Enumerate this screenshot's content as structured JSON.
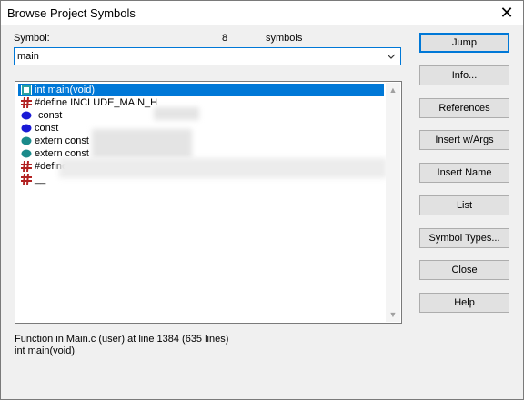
{
  "window": {
    "title": "Browse Project Symbols",
    "close_glyph": "✕"
  },
  "symbol_label": "Symbol:",
  "symbol_count": "8",
  "symbols_word": "symbols",
  "search": {
    "value": "main"
  },
  "list": [
    {
      "icon": "function-icon",
      "text": "int main(void)",
      "selected": true
    },
    {
      "icon": "define-icon",
      "text": "#define INCLUDE_MAIN_H",
      "selected": false
    },
    {
      "icon": "constant-icon",
      "text": "const",
      "selected": false
    },
    {
      "icon": "constant-icon",
      "text": "const",
      "selected": false
    },
    {
      "icon": "extern-icon",
      "text": "extern const",
      "selected": false
    },
    {
      "icon": "extern-icon",
      "text": "extern const",
      "selected": false
    },
    {
      "icon": "define-icon",
      "text": "#define",
      "selected": false
    },
    {
      "icon": "define-icon",
      "text": "__",
      "selected": false
    }
  ],
  "buttons": {
    "jump": "Jump",
    "info": "Info...",
    "references": "References",
    "insert_args": "Insert w/Args",
    "insert_name": "Insert Name",
    "list": "List",
    "symbol_types": "Symbol Types...",
    "close": "Close",
    "help": "Help"
  },
  "status": {
    "line1": "Function in Main.c (user) at line 1384 (635 lines)",
    "line2": "int main(void)"
  },
  "colors": {
    "selection": "#0078d7",
    "define_icon": "#b22222",
    "constant_icon": "#1a1ad6",
    "extern_icon": "#1a8a8a",
    "function_icon": "#2aa0a0"
  }
}
